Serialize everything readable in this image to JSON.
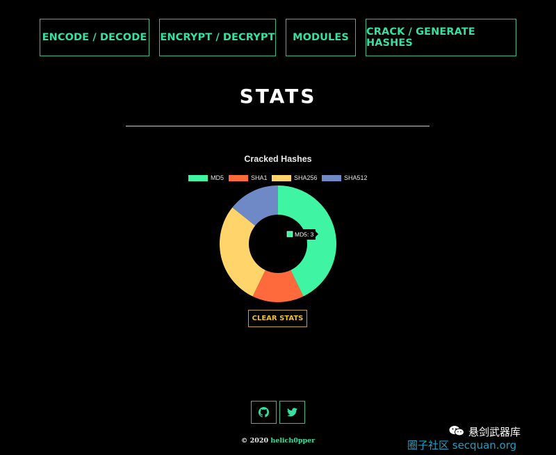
{
  "nav": {
    "items": [
      {
        "label": "ENCODE / DECODE"
      },
      {
        "label": "ENCRYPT / DECRYPT"
      },
      {
        "label": "MODULES"
      },
      {
        "label": "CRACK / GENERATE HASHES"
      }
    ]
  },
  "page_title": "STATS",
  "chart_data": {
    "type": "pie",
    "variant": "doughnut",
    "title": "Cracked Hashes",
    "categories": [
      "MD5",
      "SHA1",
      "SHA256",
      "SHA512"
    ],
    "values": [
      3,
      1,
      2,
      1
    ],
    "colors": [
      "#3ff5a3",
      "#ff6a3d",
      "#ffd56b",
      "#6f89c7"
    ],
    "legend_position": "top",
    "tooltip": {
      "label": "MD5",
      "value": 3,
      "text": "MD5: 3"
    }
  },
  "actions": {
    "clear_label": "CLEAR STATS"
  },
  "social": {
    "github_icon": "github-icon",
    "twitter_icon": "twitter-icon"
  },
  "footer": {
    "copyright": "© 2020",
    "author": "helich0pper"
  },
  "watermark": {
    "title": "悬剑武器库",
    "subtitle": "圈子社区 secquan.org"
  },
  "colors": {
    "accent": "#36e0a0",
    "warning": "#f0c030",
    "background": "#000000"
  }
}
